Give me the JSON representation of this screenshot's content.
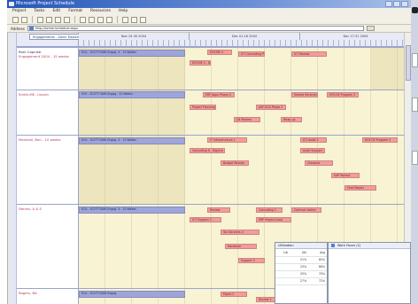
{
  "window": {
    "title": "Microsoft Project Schedule"
  },
  "menu": [
    "Project",
    "Tasks",
    "Edit",
    "Format",
    "Resources",
    "Help"
  ],
  "address": {
    "label": "Address",
    "value": "http://server/schedule.aspx"
  },
  "tab": {
    "label": "Engagements - Zone: Eastern"
  },
  "timeline": {
    "spans": [
      "Nov 15-30 2004",
      "Dec 01-16 2004",
      "Dec 17-31 2004"
    ]
  },
  "sections": [
    {
      "name": "Ram Capnistr",
      "sub": "Engagement 2004 - 15 weeks",
      "blue": "ECA - SCOTT-SKW Engag. 4 - 10 Weeks",
      "red": [
        "EGY-ME 4",
        "EGY-ME 5 - Nigeria",
        "ICT Consulting Phase 4",
        "ICT Review"
      ]
    },
    {
      "name": "Smith-ME, Lincoln",
      "sub": "",
      "blue": "EGY - SCOTT SKW Engag - 10 Weeks",
      "red": [
        "ERP Apps Phase 4",
        "Project Planning",
        "AVF-ECA Phase 2",
        "Shared Services 2",
        "EGY-GE Program 3",
        "Q4 Review",
        "Wrap-up"
      ]
    },
    {
      "name": "Marshall, Ben - 10 weeks",
      "sub": "",
      "blue": "ECA - SCOTT-SKW Engag. 4 - 10 Weeks",
      "red": [
        "IT Infrastructure 1",
        "Consulting 6 - Nigeria",
        "ICT Audit 2",
        "Audit Support",
        "EGY-GE Program 5",
        "Budget Review",
        "Closeout",
        "SAP Rollout",
        "Final Report"
      ]
    },
    {
      "name": "Dennis, A & S",
      "sub": "",
      "blue": "ECA - SCOTT-SKW Engag. 4 - 10 Weeks",
      "red": [
        "Review",
        "ICT Support 3",
        "Consulting 2",
        "ERP Project Lead",
        "Tax Services 4",
        "Contract Admin",
        "Handover",
        "Support 5"
      ]
    },
    {
      "name": "Rogers, BA",
      "sub": "",
      "blue": "ECA - SCOTT-SKW Engag.",
      "red": [
        "Mgmt 2",
        "Review 3"
      ]
    }
  ],
  "popup": {
    "title": "Utilization",
    "headers": [
      "Cal",
      "Util",
      "Avg"
    ],
    "rows": [
      [
        "",
        "21%",
        "65%"
      ],
      [
        "",
        "23%",
        "66%"
      ],
      [
        "",
        "25%",
        "70%"
      ],
      [
        "",
        "27%",
        "72%"
      ]
    ]
  },
  "panel2": {
    "title": "Work Hours (1)"
  },
  "colors": {
    "blueBar": "#9ea5da",
    "redBar": "#f39c9c",
    "grid": "#f8f3d2",
    "nameText": "#b23a56"
  }
}
